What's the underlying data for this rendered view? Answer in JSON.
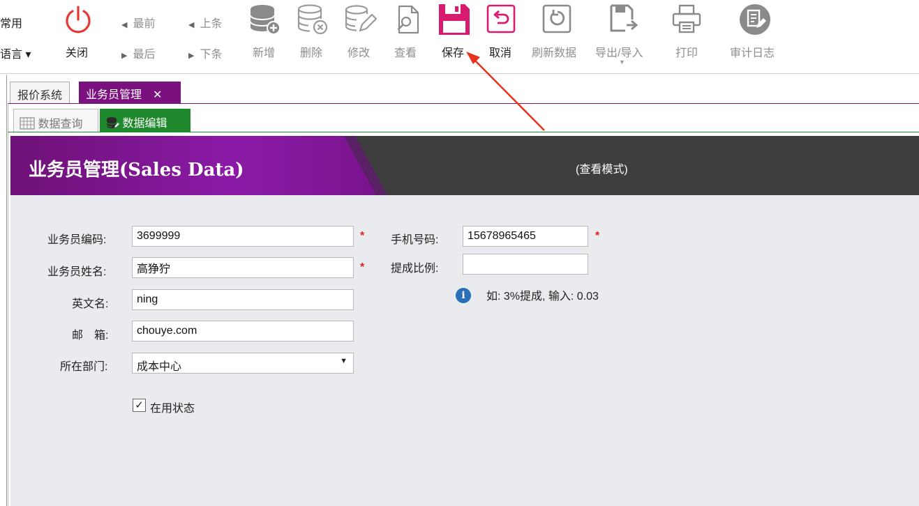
{
  "toolbar": {
    "left_items": [
      "常用",
      "语言 ▾"
    ],
    "close": "关闭",
    "nav": {
      "first": "最前",
      "last": "最后",
      "prev": "上条",
      "next": "下条"
    },
    "buttons": {
      "add": "新增",
      "delete": "删除",
      "edit": "修改",
      "view": "查看",
      "save": "保存",
      "cancel": "取消",
      "refresh": "刷新数据",
      "export": "导出/导入",
      "print": "打印",
      "audit": "审计日志"
    }
  },
  "doc_tabs": [
    {
      "label": "报价系统"
    },
    {
      "label": "业务员管理",
      "close": "✕"
    }
  ],
  "sub_tabs": [
    {
      "label": "数据查询"
    },
    {
      "label": "数据编辑"
    }
  ],
  "banner": {
    "title": "业务员管理(Sales Data)",
    "mode": "(查看模式)"
  },
  "form": {
    "code_label": "业务员编码:",
    "code_value": "3699999",
    "name_label": "业务员姓名:",
    "name_value": "高狰狞",
    "en_label": "英文名:",
    "en_value": "ning",
    "email_label": "邮　箱:",
    "email_value": "chouye.com",
    "dept_label": "所在部门:",
    "dept_value": "成本中心",
    "phone_label": "手机号码:",
    "phone_value": "15678965465",
    "ratio_label": "提成比例:",
    "ratio_value": "",
    "hint": "如: 3%提成, 输入: 0.03",
    "active_label": "在用状态",
    "required_mark": "*"
  },
  "colors": {
    "accent": "#7b117e",
    "green_tab": "#1f8a2d",
    "save_icon": "#d81b6e",
    "close_icon": "#e53935",
    "arrow": "#e8321e"
  }
}
